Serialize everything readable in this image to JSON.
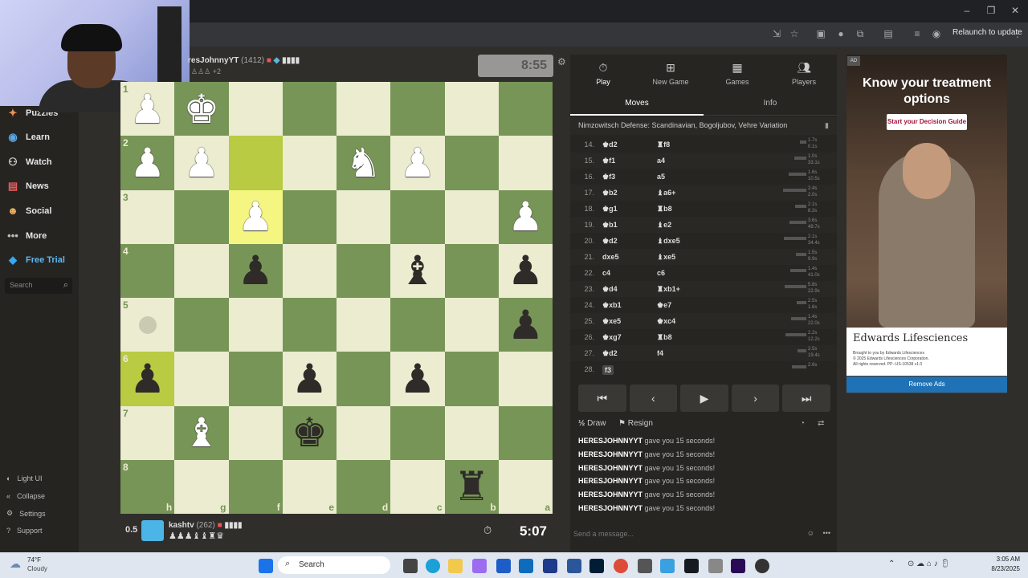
{
  "browser": {
    "relaunch_label": "Relaunch to update"
  },
  "sidebar": {
    "items": [
      {
        "label": "Puzzles",
        "icon": "puzzle-icon"
      },
      {
        "label": "Learn",
        "icon": "learn-icon"
      },
      {
        "label": "Watch",
        "icon": "watch-icon"
      },
      {
        "label": "News",
        "icon": "news-icon"
      },
      {
        "label": "Social",
        "icon": "social-icon"
      },
      {
        "label": "More",
        "icon": "more-icon"
      },
      {
        "label": "Free Trial",
        "icon": "diamond-icon"
      }
    ],
    "search_placeholder": "Search",
    "bottom": [
      {
        "label": "Light UI"
      },
      {
        "label": "Collapse"
      },
      {
        "label": "Settings"
      },
      {
        "label": "Support"
      }
    ]
  },
  "top_player": {
    "name": "resJohnnyYT",
    "rating": "(1412)",
    "material": "+2",
    "clock": "8:55"
  },
  "bottom_player": {
    "score": "0.5",
    "name": "kashtv",
    "rating": "(262)",
    "clock": "5:07"
  },
  "board": {
    "ranks": [
      "1",
      "2",
      "3",
      "4",
      "5",
      "6",
      "7",
      "8"
    ],
    "files": [
      "h",
      "g",
      "f",
      "e",
      "d",
      "c",
      "b",
      "a"
    ],
    "pieces": [
      {
        "r": 0,
        "c": 0,
        "p": "♟",
        "color": "w"
      },
      {
        "r": 0,
        "c": 1,
        "p": "♚",
        "color": "w"
      },
      {
        "r": 1,
        "c": 0,
        "p": "♟",
        "color": "w"
      },
      {
        "r": 1,
        "c": 1,
        "p": "♟",
        "color": "w"
      },
      {
        "r": 1,
        "c": 4,
        "p": "♞",
        "color": "w"
      },
      {
        "r": 1,
        "c": 5,
        "p": "♟",
        "color": "w"
      },
      {
        "r": 2,
        "c": 2,
        "p": "♟",
        "color": "w"
      },
      {
        "r": 2,
        "c": 7,
        "p": "♟",
        "color": "w"
      },
      {
        "r": 3,
        "c": 2,
        "p": "♟",
        "color": "b"
      },
      {
        "r": 3,
        "c": 5,
        "p": "♝",
        "color": "b"
      },
      {
        "r": 3,
        "c": 7,
        "p": "♟",
        "color": "b"
      },
      {
        "r": 4,
        "c": 7,
        "p": "♟",
        "color": "b"
      },
      {
        "r": 5,
        "c": 0,
        "p": "♟",
        "color": "b"
      },
      {
        "r": 5,
        "c": 3,
        "p": "♟",
        "color": "b"
      },
      {
        "r": 5,
        "c": 5,
        "p": "♟",
        "color": "b"
      },
      {
        "r": 6,
        "c": 1,
        "p": "♝",
        "color": "w"
      },
      {
        "r": 6,
        "c": 3,
        "p": "♚",
        "color": "b"
      },
      {
        "r": 7,
        "c": 6,
        "p": "♜",
        "color": "b"
      }
    ],
    "highlights": [
      {
        "r": 1,
        "c": 2
      },
      {
        "r": 2,
        "c": 2
      },
      {
        "r": 5,
        "c": 0
      }
    ],
    "dots": [
      {
        "r": 4,
        "c": 0
      }
    ]
  },
  "panel": {
    "tabs": [
      {
        "label": "Play",
        "icon": "clock-icon"
      },
      {
        "label": "New Game",
        "icon": "plus-icon"
      },
      {
        "label": "Games",
        "icon": "games-icon"
      },
      {
        "label": "Players",
        "icon": "players-icon"
      }
    ],
    "subtabs": [
      "Moves",
      "Info"
    ],
    "opening": "Nimzowitsch Defense: Scandinavian, Bogoljubov, Vehre Variation",
    "moves": [
      {
        "n": "14.",
        "w": "♚d2",
        "b": "♜f8",
        "t": "1.7s\n0.1s"
      },
      {
        "n": "15.",
        "w": "♚f1",
        "b": "a4",
        "t": "1.0s\n33.1s"
      },
      {
        "n": "16.",
        "w": "♚f3",
        "b": "a5",
        "t": "1.6s\n10.5s"
      },
      {
        "n": "17.",
        "w": "♚b2",
        "b": "♝a6+",
        "t": "2.4s\n2.0s"
      },
      {
        "n": "18.",
        "w": "♚g1",
        "b": "♜b8",
        "t": "2.1s\n8.3s"
      },
      {
        "n": "19.",
        "w": "♚b1",
        "b": "♝e2",
        "t": "3.6s\n49.7s"
      },
      {
        "n": "20.",
        "w": "♚d2",
        "b": "♝dxe5",
        "t": "2.1s\n34.4s"
      },
      {
        "n": "21.",
        "w": "dxe5",
        "b": "♝xe5",
        "t": "1.5s\n9.9s"
      },
      {
        "n": "22.",
        "w": "c4",
        "b": "c6",
        "t": "1.4s\n41.0s"
      },
      {
        "n": "23.",
        "w": "♚d4",
        "b": "♜xb1+",
        "t": "5.8s\n22.9s"
      },
      {
        "n": "24.",
        "w": "♚xb1",
        "b": "♚e7",
        "t": "2.5s\n1.6s"
      },
      {
        "n": "25.",
        "w": "♚xe5",
        "b": "♚xc4",
        "t": "1.4s\n22.0s"
      },
      {
        "n": "26.",
        "w": "♚xg7",
        "b": "♜b8",
        "t": "2.2s\n12.2s"
      },
      {
        "n": "27.",
        "w": "♚d2",
        "b": "f4",
        "t": "2.5s\n19.4s"
      },
      {
        "n": "28.",
        "w": "f3",
        "b": "",
        "t": "2.6s"
      }
    ],
    "nav": [
      "⏮",
      "◀",
      "▶",
      "▷",
      "⏭"
    ],
    "draw_label": "Draw",
    "resign_label": "Resign",
    "chat": [
      {
        "user": "HERESJOHNNYYT",
        "text": "gave you 15 seconds!"
      },
      {
        "user": "HERESJOHNNYYT",
        "text": "gave you 15 seconds!"
      },
      {
        "user": "HERESJOHNNYYT",
        "text": "gave you 15 seconds!"
      },
      {
        "user": "HERESJOHNNYYT",
        "text": "gave you 15 seconds!"
      },
      {
        "user": "HERESJOHNNYYT",
        "text": "gave you 15 seconds!"
      },
      {
        "user": "HERESJOHNNYYT",
        "text": "gave you 15 seconds!"
      }
    ],
    "message_placeholder": "Send a message..."
  },
  "ad": {
    "badge": "AD",
    "headline": "Know your treatment options",
    "cta": "Start your Decision Guide",
    "brand": "Edwards Lifesciences",
    "fine_print": "Brought to you by Edwards Lifesciences\n© 2025 Edwards Lifesciences Corporation.\nAll rights reserved. PP--US-10538 v1.0",
    "remove_label": "Remove Ads"
  },
  "taskbar": {
    "weather_temp": "74°F",
    "weather_desc": "Cloudy",
    "search_label": "Search",
    "time": "3:05 AM",
    "date": "8/23/2025"
  },
  "colors": {
    "board_light": "#ebecd0",
    "board_dark": "#779556",
    "highlight": "#f5f682",
    "ad_button": "#1e72b5"
  }
}
